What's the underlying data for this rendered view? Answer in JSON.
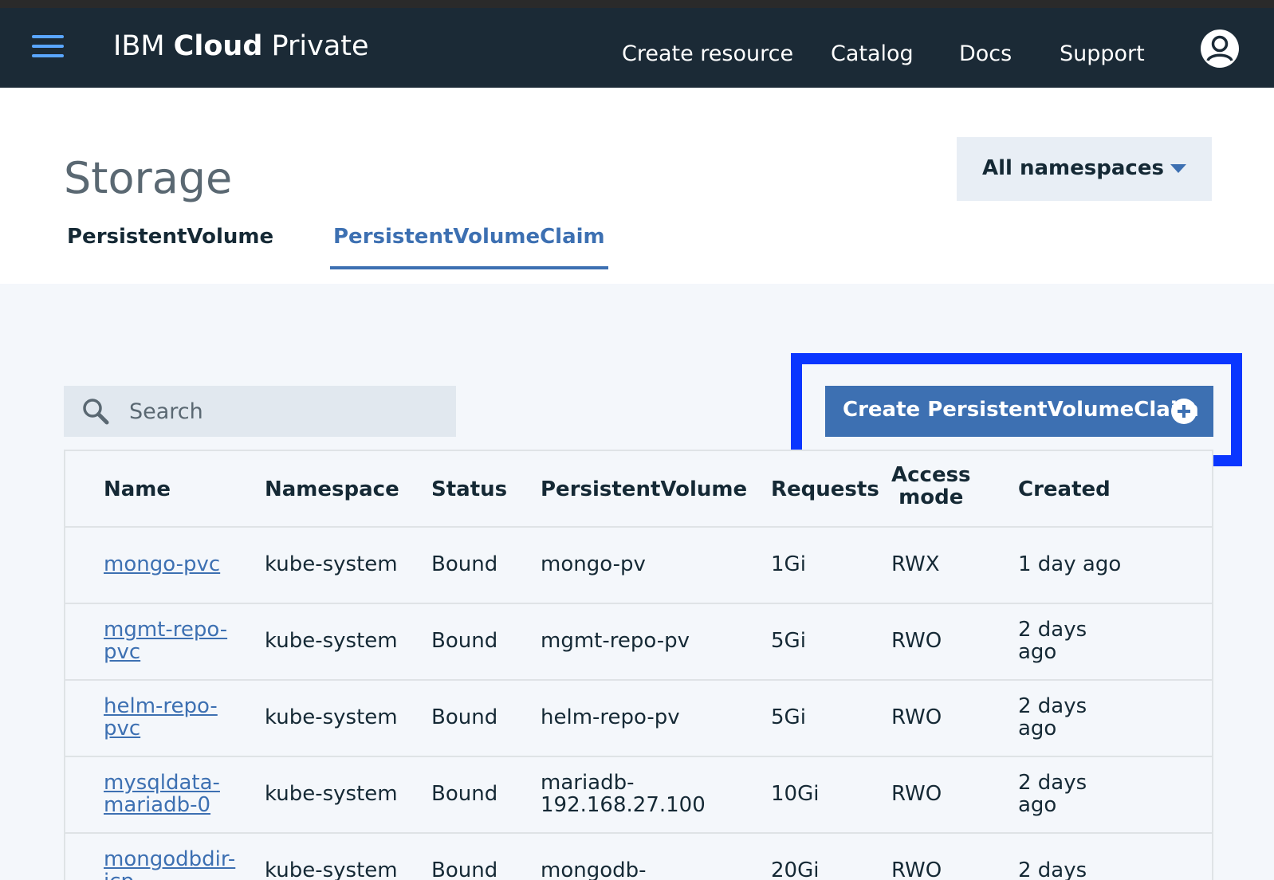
{
  "header": {
    "brand_prefix": "IBM",
    "brand_bold": "Cloud",
    "brand_suffix": "Private",
    "nav": [
      "Create resource",
      "Catalog",
      "Docs",
      "Support"
    ]
  },
  "page": {
    "title": "Storage",
    "namespace_selector": "All namespaces",
    "tabs": [
      "PersistentVolume",
      "PersistentVolumeClaim"
    ],
    "active_tab": "PersistentVolumeClaim"
  },
  "toolbar": {
    "search_placeholder": "Search",
    "create_button": "Create PersistentVolumeClaim"
  },
  "table": {
    "columns": [
      "Name",
      "Namespace",
      "Status",
      "PersistentVolume",
      "Requests",
      "Access\nmode",
      "Created"
    ],
    "rows": [
      [
        "mongo-pvc",
        "kube-system",
        "Bound",
        "mongo-pv",
        "1Gi",
        "RWX",
        "1 day ago"
      ],
      [
        "mgmt-repo-\npvc",
        "kube-system",
        "Bound",
        "mgmt-repo-pv",
        "5Gi",
        "RWO",
        "2 days\nago"
      ],
      [
        "helm-repo-\npvc",
        "kube-system",
        "Bound",
        "helm-repo-pv",
        "5Gi",
        "RWO",
        "2 days\nago"
      ],
      [
        "mysqldata-\nmariadb-0",
        "kube-system",
        "Bound",
        "mariadb-\n192.168.27.100",
        "10Gi",
        "RWO",
        "2 days\nago"
      ],
      [
        "mongodbdir-\nicp-",
        "kube-system",
        "Bound",
        "mongodb-",
        "20Gi",
        "RWO",
        "2 days"
      ]
    ]
  },
  "colors": {
    "header_bg": "#1b2a36",
    "accent": "#3d70b2",
    "highlight": "#0a36ff"
  }
}
